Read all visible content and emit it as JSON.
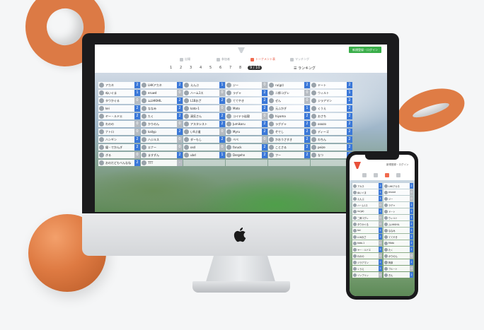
{
  "colors": {
    "accent": "#e8503a",
    "register": "#3aae4a",
    "score_blue": "#3b78d8",
    "score_gray": "#b7bcc2",
    "shape_orange": "#de7a42"
  },
  "header": {
    "register_label": "新規登録・ログイン"
  },
  "tabs": [
    {
      "label": "出場",
      "icon": "entry-icon",
      "active": false
    },
    {
      "label": "参加者",
      "icon": "user-icon",
      "active": false
    },
    {
      "label": "トーナメント表",
      "icon": "bracket-icon",
      "active": true
    },
    {
      "label": "マッチング",
      "icon": "flag-icon",
      "active": false
    }
  ],
  "pager": {
    "pages": [
      "1",
      "2",
      "3",
      "4",
      "5",
      "6",
      "7",
      "8",
      "9"
    ],
    "current": "9 / 10",
    "ranking_label": "ランキング"
  },
  "rows": [
    [
      {
        "n": "アカネ",
        "s": "2"
      },
      {
        "n": "LHKアカネ",
        "s": "2"
      },
      {
        "n": "えんぶ",
        "s": "1"
      },
      {
        "n": "ジー",
        "s": "0"
      },
      {
        "n": "ru(gz)",
        "s": "2"
      },
      {
        "n": "ドート",
        "s": "2"
      },
      {
        "n": "ubuMe",
        "s": "1"
      }
    ],
    [
      {
        "n": "ぬいぐま",
        "s": "1"
      },
      {
        "n": "eruwd",
        "s": "0"
      },
      {
        "n": "ハーム1ス",
        "s": "0"
      },
      {
        "n": "ラデャ",
        "s": "2"
      },
      {
        "n": "二郎コグレ",
        "s": "0"
      },
      {
        "n": "ウィルト",
        "s": "1"
      },
      {
        "n": "sweet",
        "s": "2"
      }
    ],
    [
      {
        "n": "タウかぐる",
        "s": "0"
      },
      {
        "n": "ムLHKIHIL",
        "s": "2"
      },
      {
        "n": "L1Bおざ",
        "s": "2"
      },
      {
        "n": "ててやき",
        "s": "2"
      },
      {
        "n": "ぜん",
        "s": "0"
      },
      {
        "n": "ジラアマン",
        "s": "2"
      },
      {
        "n": "狗原",
        "s": "2"
      }
    ],
    [
      {
        "n": "kei",
        "s": "2"
      },
      {
        "n": "ななみ",
        "s": "2"
      },
      {
        "n": "kato-1",
        "s": "0"
      },
      {
        "n": "Mato",
        "s": "2"
      },
      {
        "n": "元ふかぎ",
        "s": "1"
      },
      {
        "n": "くうえ",
        "s": "2"
      },
      {
        "n": "ブルート",
        "s": "0"
      }
    ],
    [
      {
        "n": "ヤー・ルドエ",
        "s": "2"
      },
      {
        "n": "たく",
        "s": "2"
      },
      {
        "n": "清気さん",
        "s": "2"
      },
      {
        "n": "コイテラ岩寝",
        "s": "0"
      },
      {
        "n": "hiyama",
        "s": "2"
      },
      {
        "n": "おさち",
        "s": "2"
      },
      {
        "n": "えぬ",
        "s": "2"
      }
    ],
    [
      {
        "n": "れのの",
        "s": "0"
      },
      {
        "n": "かりのん",
        "s": "0"
      },
      {
        "n": "アスタシスト",
        "s": "2"
      },
      {
        "n": "Jumikaru",
        "s": "2"
      },
      {
        "n": "ラグデャ",
        "s": "2"
      },
      {
        "n": "ooazo",
        "s": "2"
      },
      {
        "n": "みおう",
        "s": "0"
      }
    ],
    [
      {
        "n": "ナトロ",
        "s": "0"
      },
      {
        "n": "kallyp",
        "s": "2"
      },
      {
        "n": "い9ぷ道",
        "s": "0"
      },
      {
        "n": "Myru",
        "s": "2"
      },
      {
        "n": "ぞでし",
        "s": "2"
      },
      {
        "n": "ディーゴ",
        "s": "2"
      },
      {
        "n": "ぬぬ",
        "s": "2"
      }
    ],
    [
      {
        "n": "ハンギン",
        "s": "2"
      },
      {
        "n": "ハジルス",
        "s": "0"
      },
      {
        "n": "ダーもし",
        "s": "2"
      },
      {
        "n": "ぺぺ",
        "s": "0"
      },
      {
        "n": "かおうさすき",
        "s": "2"
      },
      {
        "n": "わちん",
        "s": "2"
      },
      {
        "n": "ごおぎと",
        "s": "2"
      }
    ],
    [
      {
        "n": "優・でかんぎ",
        "s": "2"
      },
      {
        "n": "エナー",
        "s": "0"
      },
      {
        "n": "osd",
        "s": "0"
      },
      {
        "n": "faruck",
        "s": "2"
      },
      {
        "n": "ことさる",
        "s": "2"
      },
      {
        "n": "peize",
        "s": "2"
      },
      {
        "n": "",
        "s": ""
      }
    ],
    [
      {
        "n": "ぎる",
        "s": "0"
      },
      {
        "n": "ますずん",
        "s": "2"
      },
      {
        "n": "ubd",
        "s": "1"
      },
      {
        "n": "Dergehn",
        "s": "2"
      },
      {
        "n": "フー",
        "s": "2"
      },
      {
        "n": "なつ",
        "s": "2"
      },
      {
        "n": "",
        "s": ""
      }
    ],
    [
      {
        "n": "おのだどもべんなね",
        "s": "2"
      },
      {
        "n": "TTT",
        "s": "-"
      },
      {
        "n": "",
        "s": ""
      },
      {
        "n": "",
        "s": ""
      },
      {
        "n": "",
        "s": ""
      },
      {
        "n": "",
        "s": ""
      },
      {
        "n": "",
        "s": ""
      }
    ]
  ],
  "phone": {
    "register_label": "新規登録・ログイン",
    "rows": [
      [
        {
          "n": "アカネ",
          "s": "2"
        },
        {
          "n": "LHKアカネ",
          "s": "2"
        }
      ],
      [
        {
          "n": "ぬいぐま",
          "s": "1"
        },
        {
          "n": "eruwd",
          "s": "0"
        }
      ],
      [
        {
          "n": "えんぶ",
          "s": "1"
        },
        {
          "n": "ジー",
          "s": "0"
        }
      ],
      [
        {
          "n": "ハーム1ス",
          "s": "0"
        },
        {
          "n": "ラデャ",
          "s": "2"
        }
      ],
      [
        {
          "n": "ru(gz)",
          "s": "2"
        },
        {
          "n": "ドート",
          "s": "2"
        }
      ],
      [
        {
          "n": "二郎コグレ",
          "s": "0"
        },
        {
          "n": "ウィルト",
          "s": "1"
        }
      ],
      [
        {
          "n": "タウかぐる",
          "s": "0"
        },
        {
          "n": "ムLHKIHIL",
          "s": "2"
        }
      ],
      [
        {
          "n": "kei",
          "s": "2"
        },
        {
          "n": "ななみ",
          "s": "2"
        }
      ],
      [
        {
          "n": "L1Bおざ",
          "s": "2"
        },
        {
          "n": "ててやき",
          "s": "2"
        }
      ],
      [
        {
          "n": "kato-1",
          "s": "0"
        },
        {
          "n": "Mato",
          "s": "2"
        }
      ],
      [
        {
          "n": "ヤー・ルドエ",
          "s": "2"
        },
        {
          "n": "たく",
          "s": "2"
        }
      ],
      [
        {
          "n": "れのの",
          "s": "0"
        },
        {
          "n": "かりのん",
          "s": "0"
        }
      ],
      [
        {
          "n": "ジラアマン",
          "s": "2"
        },
        {
          "n": "狗原",
          "s": "2"
        }
      ],
      [
        {
          "n": "くうえ",
          "s": "2"
        },
        {
          "n": "ブルート",
          "s": "0"
        }
      ],
      [
        {
          "n": "ゾンブリン",
          "s": "0"
        },
        {
          "n": "ぎん",
          "s": "2"
        }
      ]
    ]
  }
}
